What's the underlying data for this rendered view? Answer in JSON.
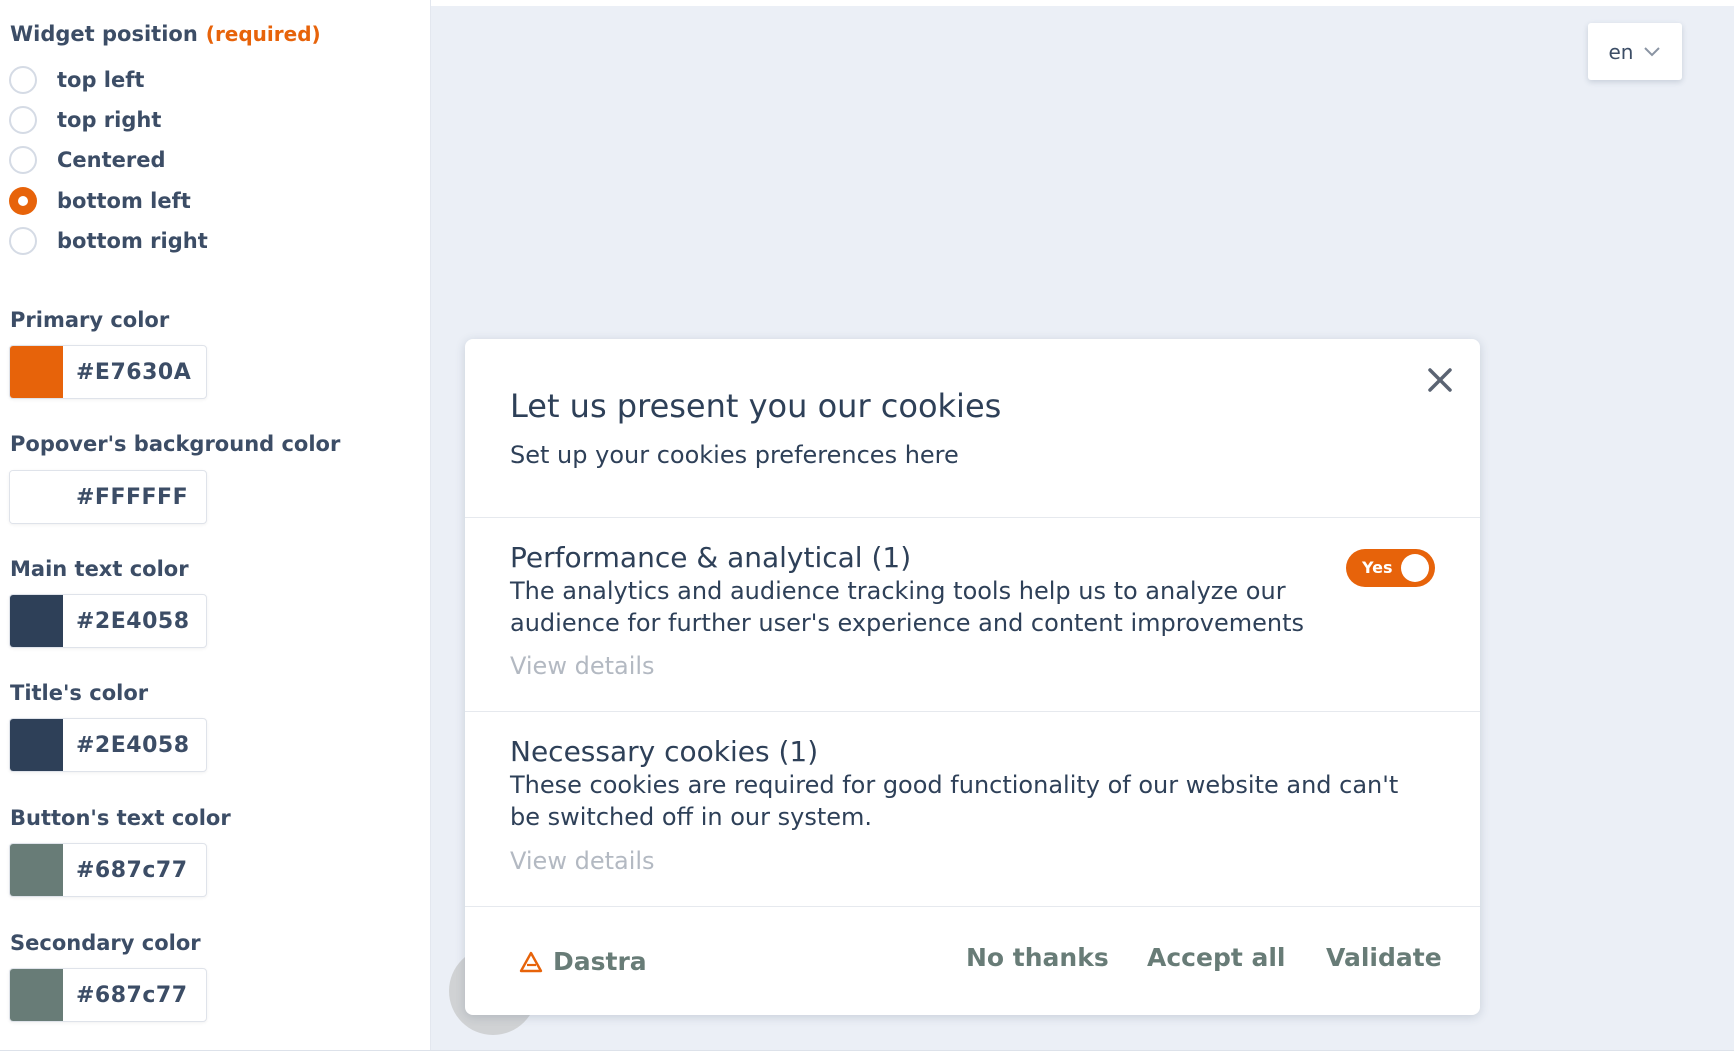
{
  "settings": {
    "widget_position": {
      "label": "Widget position",
      "required_label": "(required)",
      "options": [
        {
          "label": "top left",
          "checked": false
        },
        {
          "label": "top right",
          "checked": false
        },
        {
          "label": "Centered",
          "checked": false
        },
        {
          "label": "bottom left",
          "checked": true
        },
        {
          "label": "bottom right",
          "checked": false
        }
      ]
    },
    "colors": [
      {
        "label": "Primary color",
        "value": "#E7630A"
      },
      {
        "label": "Popover's background color",
        "value": "#FFFFFF"
      },
      {
        "label": "Main text color",
        "value": "#2E4058"
      },
      {
        "label": "Title's color",
        "value": "#2E4058"
      },
      {
        "label": "Button's text color",
        "value": "#687c77"
      },
      {
        "label": "Secondary color",
        "value": "#687c77"
      }
    ]
  },
  "preview": {
    "language": "en",
    "popover": {
      "title": "Let us present you our cookies",
      "subtitle": "Set up your cookies preferences here",
      "categories": [
        {
          "title": "Performance & analytical (1)",
          "description": "The analytics and audience tracking tools help us to analyze our audience for further user's experience and content improvements",
          "details_label": "View details",
          "toggle_label": "Yes",
          "enabled": true
        },
        {
          "title": "Necessary cookies (1)",
          "description": "These cookies are required for good functionality of our website and can't be switched off in our system.",
          "details_label": "View details"
        }
      ],
      "footer": {
        "brand": "Dastra",
        "no_thanks": "No thanks",
        "accept_all": "Accept all",
        "validate": "Validate"
      }
    }
  },
  "theme": {
    "primary": "#E7630A",
    "popover_bg": "#FFFFFF",
    "main_text": "#2E4058",
    "title": "#2E4058",
    "button_text": "#687c77",
    "secondary": "#687c77"
  }
}
